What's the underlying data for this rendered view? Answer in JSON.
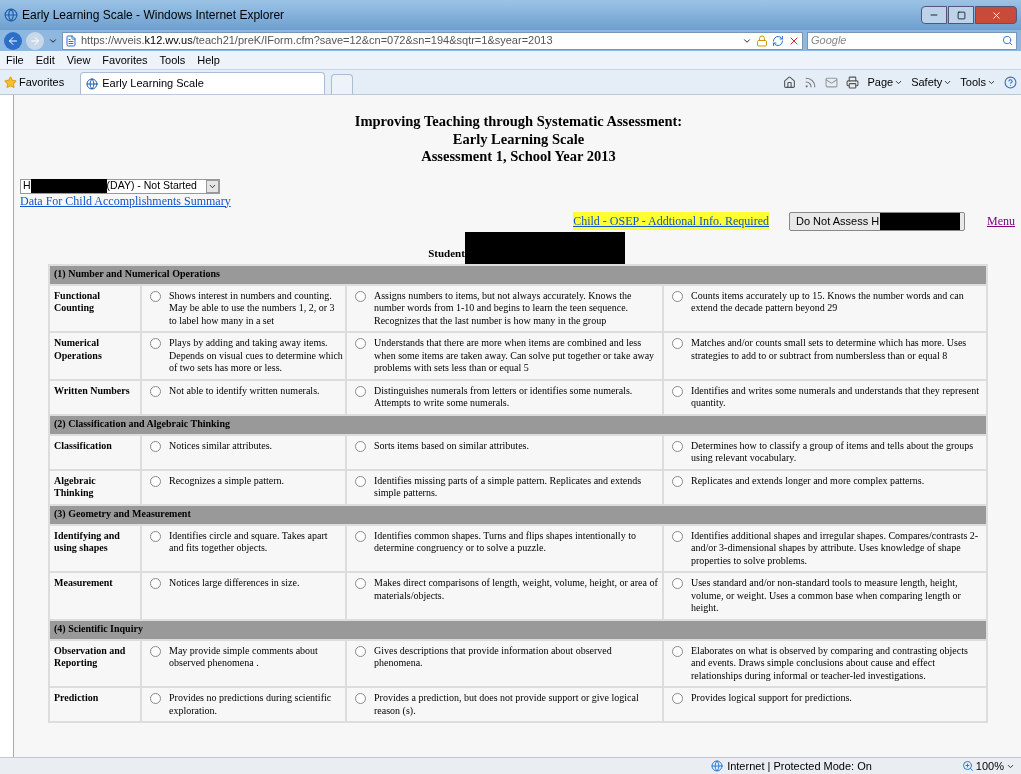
{
  "window": {
    "title": "Early Learning Scale - Windows Internet Explorer"
  },
  "address_bar": {
    "url_prefix": "https://wveis.",
    "url_domain": "k12.wv.us",
    "url_path": "/teach21/preK/IForm.cfm?save=12&cn=072&sn=194&sqtr=1&syear=2013"
  },
  "search": {
    "placeholder": "Google"
  },
  "menu": [
    "File",
    "Edit",
    "View",
    "Favorites",
    "Tools",
    "Help"
  ],
  "favorites_bar": {
    "favorites": "Favorites",
    "tab": "Early Learning Scale",
    "commands": [
      "Page",
      "Safety",
      "Tools"
    ]
  },
  "page": {
    "title_lines": [
      "Improving Teaching through Systematic Assessment:",
      "Early Learning Scale",
      "Assessment 1, School Year 2013"
    ],
    "child_select": {
      "prefix": "H",
      "suffix": "(DAY) - Not Started"
    },
    "summary_link": "Data For Child Accomplishments Summary",
    "osep_link": "Child - OSEP - Addtional Info. Required",
    "do_not_assess": "Do Not Assess H",
    "menu_link": "Menu",
    "student_label": "Student"
  },
  "sections": [
    {
      "title": "(1) Number and Numerical Operations",
      "rows": [
        {
          "label": "Functional Counting",
          "options": [
            {
              "text": "Shows interest in numbers and counting. May be able to use the numbers 1, 2, or 3 to label how many in a set",
              "selected": false
            },
            {
              "text": "Assigns numbers to items, but not always accurately. Knows the number words from 1-10 and begins to learn the teen sequence. Recognizes that the last number is how many in the group",
              "selected": false
            },
            {
              "text": "Counts items accurately up to 15. Knows the number words and can extend the decade pattern beyond 29",
              "selected": false
            }
          ]
        },
        {
          "label": "Numerical Operations",
          "options": [
            {
              "text": "Plays by adding and taking away items. Depends on visual cues to determine which of two sets has more or less.",
              "selected": false
            },
            {
              "text": "Understands that there are more when items are combined and less when some items are taken away. Can solve put together or take away problems with sets less than or equal 5",
              "selected": false
            },
            {
              "text": "Matches and/or counts small sets to determine which has more. Uses strategies to add to or subtract from numbersless than or equal 8",
              "selected": false
            }
          ]
        },
        {
          "label": "Written Numbers",
          "options": [
            {
              "text": "Not able to identify written numerals.",
              "selected": false
            },
            {
              "text": "Distinguishes numerals from letters or identifies some numerals. Attempts to write some numerals.",
              "selected": false
            },
            {
              "text": "Identifies and writes some numerals and understands that they represent quantity.",
              "selected": false
            }
          ]
        }
      ]
    },
    {
      "title": "(2) Classification and Algebraic Thinking",
      "rows": [
        {
          "label": "Classification",
          "options": [
            {
              "text": "Notices similar attributes.",
              "selected": false
            },
            {
              "text": "Sorts items based on similar attributes.",
              "selected": false
            },
            {
              "text": "Determines how to classify a group of items and tells about the groups using relevant vocabulary.",
              "selected": false
            }
          ]
        },
        {
          "label": "Algebraic Thinking",
          "options": [
            {
              "text": "Recognizes a simple pattern.",
              "selected": false
            },
            {
              "text": "Identifies missing parts of a simple pattern. Replicates and extends simple patterns.",
              "selected": false
            },
            {
              "text": "Replicates and extends longer and more complex patterns.",
              "selected": false
            }
          ]
        }
      ]
    },
    {
      "title": "(3) Geometry and Measurement",
      "rows": [
        {
          "label": "Identifying and using shapes",
          "options": [
            {
              "text": "Identifies circle and square. Takes apart and fits together objects.",
              "selected": false
            },
            {
              "text": "Identifies common shapes. Turns and flips shapes intentionally to determine congruency or to solve a puzzle.",
              "selected": false
            },
            {
              "text": "Identifies additional shapes and irregular shapes. Compares/contrasts 2- and/or 3-dimensional shapes by attribute. Uses knowledge of shape properties to solve problems.",
              "selected": false
            }
          ]
        },
        {
          "label": "Measurement",
          "options": [
            {
              "text": "Notices large differences in size.",
              "selected": false
            },
            {
              "text": "Makes direct comparisons of length, weight, volume, height, or area of materials/objects.",
              "selected": false
            },
            {
              "text": "Uses standard and/or non-standard tools to measure length, height, volume, or weight. Uses a common base when comparing length or height.",
              "selected": false
            }
          ]
        }
      ]
    },
    {
      "title": "(4) Scientific Inquiry",
      "rows": [
        {
          "label": "Observation and Reporting",
          "options": [
            {
              "text": "May provide simple comments about observed phenomena .",
              "selected": false
            },
            {
              "text": "Gives descriptions that provide information about observed phenomena.",
              "selected": false
            },
            {
              "text": "Elaborates on what is observed by comparing and contrasting objects and events. Draws simple conclusions about cause and effect relationships during informal or teacher-led investigations.",
              "selected": false
            }
          ]
        },
        {
          "label": "Prediction",
          "options": [
            {
              "text": "Provides no predictions during scientific exploration.",
              "selected": false
            },
            {
              "text": "Provides a prediction, but does not provide support or give logical reason (s).",
              "selected": false
            },
            {
              "text": "Provides logical support for predictions.",
              "selected": false
            }
          ]
        }
      ]
    }
  ],
  "status_bar": {
    "zone": "Internet | Protected Mode: On",
    "zoom": "100%"
  }
}
